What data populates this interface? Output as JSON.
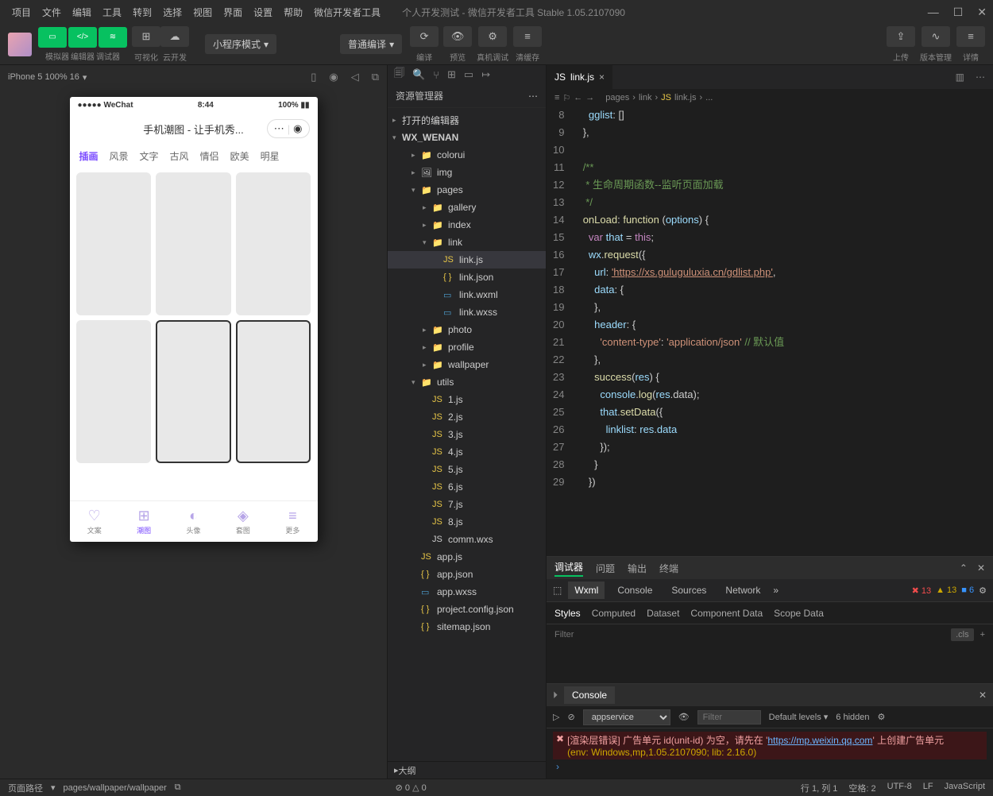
{
  "menu": [
    "项目",
    "文件",
    "编辑",
    "工具",
    "转到",
    "选择",
    "视图",
    "界面",
    "设置",
    "帮助",
    "微信开发者工具"
  ],
  "window_title": "个人开发测试 - 微信开发者工具 Stable 1.05.2107090",
  "toolbar": {
    "mode_labels": [
      "模拟器",
      "编辑器",
      "调试器"
    ],
    "viz": "可视化",
    "cloud": "云开发",
    "compile_mode": "小程序模式",
    "compile_type": "普通编译",
    "actions": [
      "编译",
      "预览",
      "真机调试",
      "清缓存"
    ],
    "right": [
      "上传",
      "版本管理",
      "详情"
    ]
  },
  "sim": {
    "device": "iPhone 5 100% 16",
    "ph_wechat": "●●●●● WeChat",
    "ph_time": "8:44",
    "ph_batt": "100%",
    "ph_title": "手机潮图 - 让手机秀...",
    "ph_tabs": [
      "插画",
      "风景",
      "文字",
      "古风",
      "情侣",
      "欧美",
      "明星"
    ],
    "ph_nav": [
      "文案",
      "潮图",
      "头像",
      "套图",
      "更多"
    ]
  },
  "explorer": {
    "title": "资源管理器",
    "editors": "打开的编辑器",
    "project": "WX_WENAN",
    "tree": [
      {
        "depth": 2,
        "type": "folder",
        "name": "colorui",
        "open": false
      },
      {
        "depth": 2,
        "type": "img",
        "name": "img",
        "open": false
      },
      {
        "depth": 2,
        "type": "folder",
        "name": "pages",
        "open": true
      },
      {
        "depth": 3,
        "type": "folder",
        "name": "gallery",
        "open": false
      },
      {
        "depth": 3,
        "type": "folder",
        "name": "index",
        "open": false
      },
      {
        "depth": 3,
        "type": "folder",
        "name": "link",
        "open": true
      },
      {
        "depth": 4,
        "type": "js",
        "name": "link.js",
        "selected": true
      },
      {
        "depth": 4,
        "type": "json",
        "name": "link.json"
      },
      {
        "depth": 4,
        "type": "wxml",
        "name": "link.wxml"
      },
      {
        "depth": 4,
        "type": "wxss",
        "name": "link.wxss"
      },
      {
        "depth": 3,
        "type": "folder",
        "name": "photo",
        "open": false
      },
      {
        "depth": 3,
        "type": "folder",
        "name": "profile",
        "open": false
      },
      {
        "depth": 3,
        "type": "folder",
        "name": "wallpaper",
        "open": false
      },
      {
        "depth": 2,
        "type": "folder",
        "name": "utils",
        "open": true
      },
      {
        "depth": 3,
        "type": "js",
        "name": "1.js"
      },
      {
        "depth": 3,
        "type": "js",
        "name": "2.js"
      },
      {
        "depth": 3,
        "type": "js",
        "name": "3.js"
      },
      {
        "depth": 3,
        "type": "js",
        "name": "4.js"
      },
      {
        "depth": 3,
        "type": "js",
        "name": "5.js"
      },
      {
        "depth": 3,
        "type": "js",
        "name": "6.js"
      },
      {
        "depth": 3,
        "type": "js",
        "name": "7.js"
      },
      {
        "depth": 3,
        "type": "js",
        "name": "8.js"
      },
      {
        "depth": 3,
        "type": "wxs",
        "name": "comm.wxs"
      },
      {
        "depth": 2,
        "type": "js",
        "name": "app.js"
      },
      {
        "depth": 2,
        "type": "json",
        "name": "app.json"
      },
      {
        "depth": 2,
        "type": "wxss",
        "name": "app.wxss"
      },
      {
        "depth": 2,
        "type": "json",
        "name": "project.config.json"
      },
      {
        "depth": 2,
        "type": "json",
        "name": "sitemap.json"
      }
    ],
    "outline": "大纲"
  },
  "editor": {
    "tab": "link.js",
    "breadcrumb": [
      "pages",
      "link",
      "link.js",
      "..."
    ],
    "line_start": 8,
    "lines": [
      {
        "n": 8,
        "t": "    gglist: []",
        "cls": "prop"
      },
      {
        "n": 9,
        "t": "  },"
      },
      {
        "n": 10,
        "t": ""
      },
      {
        "n": 11,
        "t": "  /**",
        "cls": "cmt"
      },
      {
        "n": 12,
        "t": "   * 生命周期函数--监听页面加载",
        "cls": "cmt"
      },
      {
        "n": 13,
        "t": "   */",
        "cls": "cmt"
      },
      {
        "n": 14,
        "t": "  onLoad: function (options) {",
        "cls": "fn"
      },
      {
        "n": 15,
        "t": "    var that = this;",
        "cls": "key"
      },
      {
        "n": 16,
        "t": "    wx.request({",
        "cls": "fn"
      },
      {
        "n": 17,
        "t": "      url: 'https://xs.guluguluxia.cn/gdlist.php',",
        "cls": "url"
      },
      {
        "n": 18,
        "t": "      data: {",
        "cls": "prop"
      },
      {
        "n": 19,
        "t": "      },",
        "cls": "punc"
      },
      {
        "n": 20,
        "t": "      header: {",
        "cls": "prop"
      },
      {
        "n": 21,
        "t": "        'content-type': 'application/json' // 默认值",
        "cls": "str"
      },
      {
        "n": 22,
        "t": "      },",
        "cls": "punc"
      },
      {
        "n": 23,
        "t": "      success(res) {",
        "cls": "fn"
      },
      {
        "n": 24,
        "t": "        console.log(res.data);",
        "cls": "fn"
      },
      {
        "n": 25,
        "t": "        that.setData({",
        "cls": "fn"
      },
      {
        "n": 26,
        "t": "          linklist: res.data",
        "cls": "prop"
      },
      {
        "n": 27,
        "t": "        });",
        "cls": "punc"
      },
      {
        "n": 28,
        "t": "      }",
        "cls": "punc"
      },
      {
        "n": 29,
        "t": "    })",
        "cls": "punc"
      }
    ]
  },
  "debugger": {
    "tabs": [
      "调试器",
      "问题",
      "输出",
      "终端"
    ],
    "subtabs": [
      "Wxml",
      "Console",
      "Sources",
      "Network"
    ],
    "err_count": 13,
    "warn_count": 13,
    "info_count": 6,
    "style_tabs": [
      "Styles",
      "Computed",
      "Dataset",
      "Component Data",
      "Scope Data"
    ],
    "filter_placeholder": "Filter",
    "cls": ".cls"
  },
  "console": {
    "title": "Console",
    "context": "appservice",
    "filter_placeholder": "Filter",
    "levels": "Default levels",
    "hidden": "6 hidden",
    "error": "[渲染层错误] 广告单元 id(unit-id) 为空，请先在 '",
    "error_link": "https://mp.weixin.qq.com",
    "error_tail": "' 上创建广告单元",
    "env": "(env: Windows,mp,1.05.2107090; lib: 2.16.0)"
  },
  "status": {
    "left_label": "页面路径",
    "left_path": "pages/wallpaper/wallpaper",
    "problems": "⊘ 0 △ 0",
    "right": [
      "行 1, 列 1",
      "空格: 2",
      "UTF-8",
      "LF",
      "JavaScript"
    ]
  }
}
